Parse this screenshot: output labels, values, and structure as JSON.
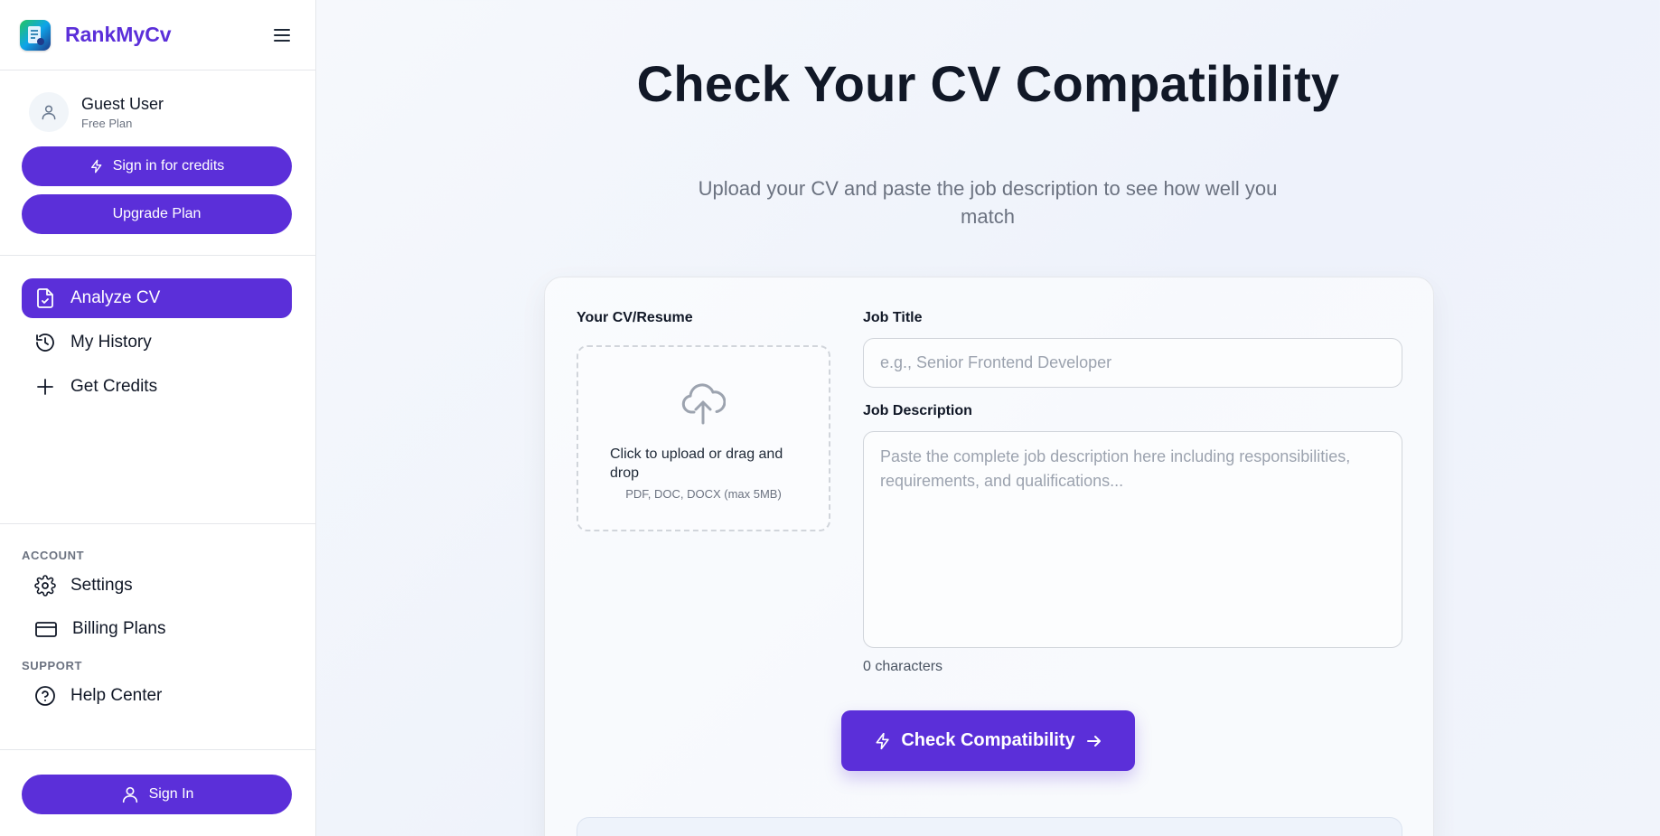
{
  "app": {
    "name": "RankMyCv"
  },
  "user": {
    "name": "Guest User",
    "plan": "Free Plan"
  },
  "sidebar": {
    "sign_in_credits_label": "Sign in for credits",
    "upgrade_label": "Upgrade Plan",
    "nav": [
      {
        "label": "Analyze CV",
        "icon": "document-check-icon",
        "active": true
      },
      {
        "label": "My History",
        "icon": "history-icon",
        "active": false
      },
      {
        "label": "Get Credits",
        "icon": "plus-icon",
        "active": false
      }
    ],
    "account_label": "ACCOUNT",
    "account_items": [
      {
        "label": "Settings",
        "icon": "gear-icon"
      },
      {
        "label": "Billing Plans",
        "icon": "credit-card-icon"
      }
    ],
    "support_label": "SUPPORT",
    "support_items": [
      {
        "label": "Help Center",
        "icon": "help-circle-icon"
      }
    ],
    "sign_in_label": "Sign In"
  },
  "main": {
    "title": "Check Your CV Compatibility",
    "subtitle": "Upload your CV and paste the job description to see how well you match",
    "cv_label": "Your CV/Resume",
    "upload_text": "Click to upload or drag and drop",
    "upload_hint": "PDF, DOC, DOCX (max 5MB)",
    "job_title_label": "Job Title",
    "job_title_value": "",
    "job_title_placeholder": "e.g., Senior Frontend Developer",
    "job_desc_label": "Job Description",
    "job_desc_value": "",
    "job_desc_placeholder": "Paste the complete job description here including responsibilities, requirements, and qualifications...",
    "char_count": "0 characters",
    "check_button_label": "Check Compatibility"
  },
  "colors": {
    "accent": "#5b2fd9",
    "text": "#111827",
    "muted": "#6b7280",
    "border": "#e5e7eb"
  }
}
